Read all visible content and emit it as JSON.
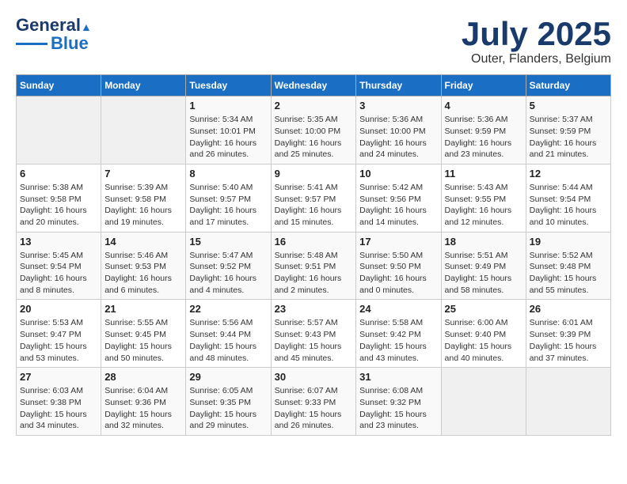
{
  "logo": {
    "line1": "General",
    "line2": "Blue"
  },
  "title": "July 2025",
  "subtitle": "Outer, Flanders, Belgium",
  "days_of_week": [
    "Sunday",
    "Monday",
    "Tuesday",
    "Wednesday",
    "Thursday",
    "Friday",
    "Saturday"
  ],
  "weeks": [
    [
      {
        "day": "",
        "info": ""
      },
      {
        "day": "",
        "info": ""
      },
      {
        "day": "1",
        "info": "Sunrise: 5:34 AM\nSunset: 10:01 PM\nDaylight: 16 hours\nand 26 minutes."
      },
      {
        "day": "2",
        "info": "Sunrise: 5:35 AM\nSunset: 10:00 PM\nDaylight: 16 hours\nand 25 minutes."
      },
      {
        "day": "3",
        "info": "Sunrise: 5:36 AM\nSunset: 10:00 PM\nDaylight: 16 hours\nand 24 minutes."
      },
      {
        "day": "4",
        "info": "Sunrise: 5:36 AM\nSunset: 9:59 PM\nDaylight: 16 hours\nand 23 minutes."
      },
      {
        "day": "5",
        "info": "Sunrise: 5:37 AM\nSunset: 9:59 PM\nDaylight: 16 hours\nand 21 minutes."
      }
    ],
    [
      {
        "day": "6",
        "info": "Sunrise: 5:38 AM\nSunset: 9:58 PM\nDaylight: 16 hours\nand 20 minutes."
      },
      {
        "day": "7",
        "info": "Sunrise: 5:39 AM\nSunset: 9:58 PM\nDaylight: 16 hours\nand 19 minutes."
      },
      {
        "day": "8",
        "info": "Sunrise: 5:40 AM\nSunset: 9:57 PM\nDaylight: 16 hours\nand 17 minutes."
      },
      {
        "day": "9",
        "info": "Sunrise: 5:41 AM\nSunset: 9:57 PM\nDaylight: 16 hours\nand 15 minutes."
      },
      {
        "day": "10",
        "info": "Sunrise: 5:42 AM\nSunset: 9:56 PM\nDaylight: 16 hours\nand 14 minutes."
      },
      {
        "day": "11",
        "info": "Sunrise: 5:43 AM\nSunset: 9:55 PM\nDaylight: 16 hours\nand 12 minutes."
      },
      {
        "day": "12",
        "info": "Sunrise: 5:44 AM\nSunset: 9:54 PM\nDaylight: 16 hours\nand 10 minutes."
      }
    ],
    [
      {
        "day": "13",
        "info": "Sunrise: 5:45 AM\nSunset: 9:54 PM\nDaylight: 16 hours\nand 8 minutes."
      },
      {
        "day": "14",
        "info": "Sunrise: 5:46 AM\nSunset: 9:53 PM\nDaylight: 16 hours\nand 6 minutes."
      },
      {
        "day": "15",
        "info": "Sunrise: 5:47 AM\nSunset: 9:52 PM\nDaylight: 16 hours\nand 4 minutes."
      },
      {
        "day": "16",
        "info": "Sunrise: 5:48 AM\nSunset: 9:51 PM\nDaylight: 16 hours\nand 2 minutes."
      },
      {
        "day": "17",
        "info": "Sunrise: 5:50 AM\nSunset: 9:50 PM\nDaylight: 16 hours\nand 0 minutes."
      },
      {
        "day": "18",
        "info": "Sunrise: 5:51 AM\nSunset: 9:49 PM\nDaylight: 15 hours\nand 58 minutes."
      },
      {
        "day": "19",
        "info": "Sunrise: 5:52 AM\nSunset: 9:48 PM\nDaylight: 15 hours\nand 55 minutes."
      }
    ],
    [
      {
        "day": "20",
        "info": "Sunrise: 5:53 AM\nSunset: 9:47 PM\nDaylight: 15 hours\nand 53 minutes."
      },
      {
        "day": "21",
        "info": "Sunrise: 5:55 AM\nSunset: 9:45 PM\nDaylight: 15 hours\nand 50 minutes."
      },
      {
        "day": "22",
        "info": "Sunrise: 5:56 AM\nSunset: 9:44 PM\nDaylight: 15 hours\nand 48 minutes."
      },
      {
        "day": "23",
        "info": "Sunrise: 5:57 AM\nSunset: 9:43 PM\nDaylight: 15 hours\nand 45 minutes."
      },
      {
        "day": "24",
        "info": "Sunrise: 5:58 AM\nSunset: 9:42 PM\nDaylight: 15 hours\nand 43 minutes."
      },
      {
        "day": "25",
        "info": "Sunrise: 6:00 AM\nSunset: 9:40 PM\nDaylight: 15 hours\nand 40 minutes."
      },
      {
        "day": "26",
        "info": "Sunrise: 6:01 AM\nSunset: 9:39 PM\nDaylight: 15 hours\nand 37 minutes."
      }
    ],
    [
      {
        "day": "27",
        "info": "Sunrise: 6:03 AM\nSunset: 9:38 PM\nDaylight: 15 hours\nand 34 minutes."
      },
      {
        "day": "28",
        "info": "Sunrise: 6:04 AM\nSunset: 9:36 PM\nDaylight: 15 hours\nand 32 minutes."
      },
      {
        "day": "29",
        "info": "Sunrise: 6:05 AM\nSunset: 9:35 PM\nDaylight: 15 hours\nand 29 minutes."
      },
      {
        "day": "30",
        "info": "Sunrise: 6:07 AM\nSunset: 9:33 PM\nDaylight: 15 hours\nand 26 minutes."
      },
      {
        "day": "31",
        "info": "Sunrise: 6:08 AM\nSunset: 9:32 PM\nDaylight: 15 hours\nand 23 minutes."
      },
      {
        "day": "",
        "info": ""
      },
      {
        "day": "",
        "info": ""
      }
    ]
  ]
}
